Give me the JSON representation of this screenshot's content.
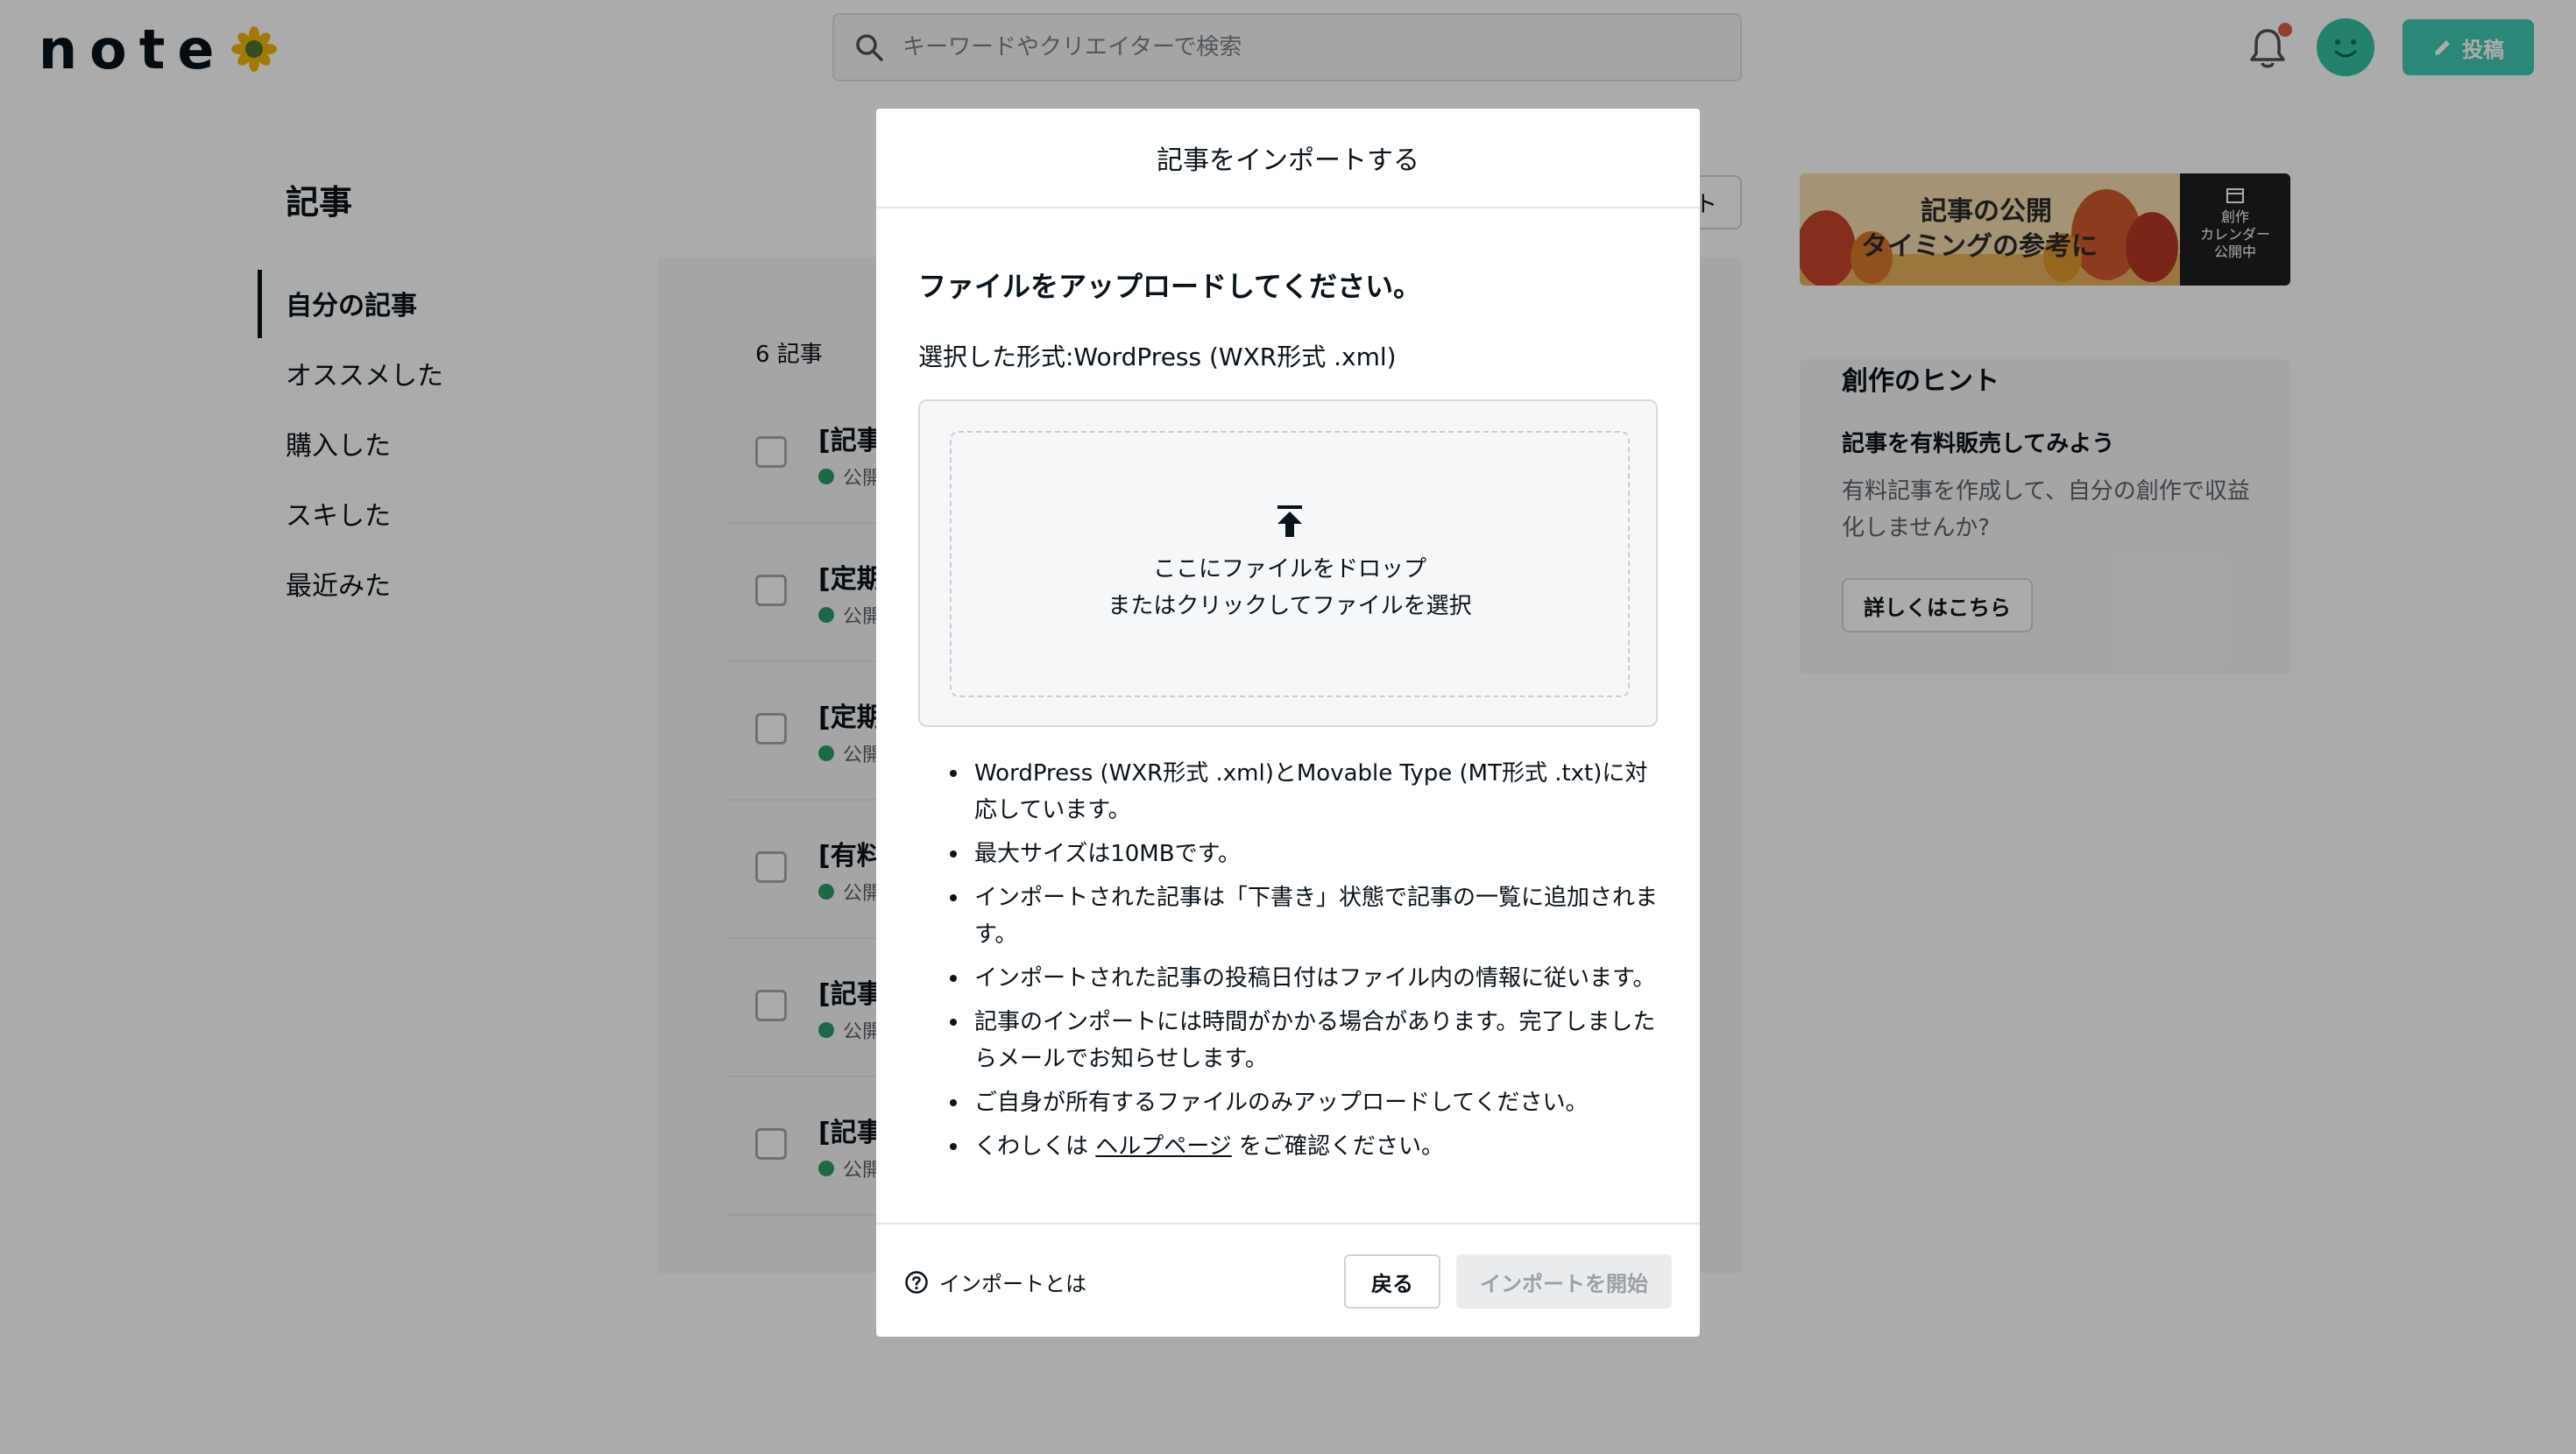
{
  "header": {
    "logo_text": "note",
    "search_placeholder": "キーワードやクリエイターで検索",
    "post_label": "投稿",
    "accent_color": "#41c9b4"
  },
  "sidebar": {
    "title": "記事",
    "items": [
      {
        "label": "自分の記事",
        "active": true
      },
      {
        "label": "オススメした",
        "active": false
      },
      {
        "label": "購入した",
        "active": false
      },
      {
        "label": "スキした",
        "active": false
      },
      {
        "label": "最近みた",
        "active": false
      }
    ]
  },
  "articles": {
    "count_label": "6 記事",
    "import_button_label": "ト",
    "rows": [
      {
        "title": "[記事",
        "status": "公開"
      },
      {
        "title": "[定期",
        "status": "公開"
      },
      {
        "title": "[定期",
        "status": "公開"
      },
      {
        "title": "[有料",
        "status": "公開"
      },
      {
        "title": "[記事",
        "status": "公開"
      },
      {
        "title": "[記事",
        "status": "公開"
      }
    ]
  },
  "banner": {
    "line1": "記事の公開",
    "line2": "タイミングの参考に",
    "side_lines": [
      "創作",
      "カレンダー",
      "公開中"
    ]
  },
  "hint": {
    "title": "創作のヒント",
    "subtitle": "記事を有料販売してみよう",
    "body": "有料記事を作成して、自分の創作で収益化しませんか?",
    "button_label": "詳しくはこちら"
  },
  "modal": {
    "title": "記事をインポートする",
    "lead": "ファイルをアップロードしてください。",
    "format": "選択した形式:WordPress (WXR形式 .xml)",
    "drop_line1": "ここにファイルをドロップ",
    "drop_line2": "またはクリックしてファイルを選択",
    "notes": [
      "WordPress (WXR形式 .xml)とMovable Type (MT形式 .txt)に対応しています。",
      "最大サイズは10MBです。",
      "インポートされた記事は「下書き」状態で記事の一覧に追加されます。",
      "インポートされた記事の投稿日付はファイル内の情報に従います。",
      "記事のインポートには時間がかかる場合があります。完了しましたらメールでお知らせします。",
      "ご自身が所有するファイルのみアップロードしてください。"
    ],
    "help_note_prefix": "くわしくは",
    "help_note_link": "ヘルプページ",
    "help_note_suffix": "をご確認ください。",
    "footer_help": "インポートとは",
    "back_label": "戻る",
    "start_label": "インポートを開始"
  }
}
